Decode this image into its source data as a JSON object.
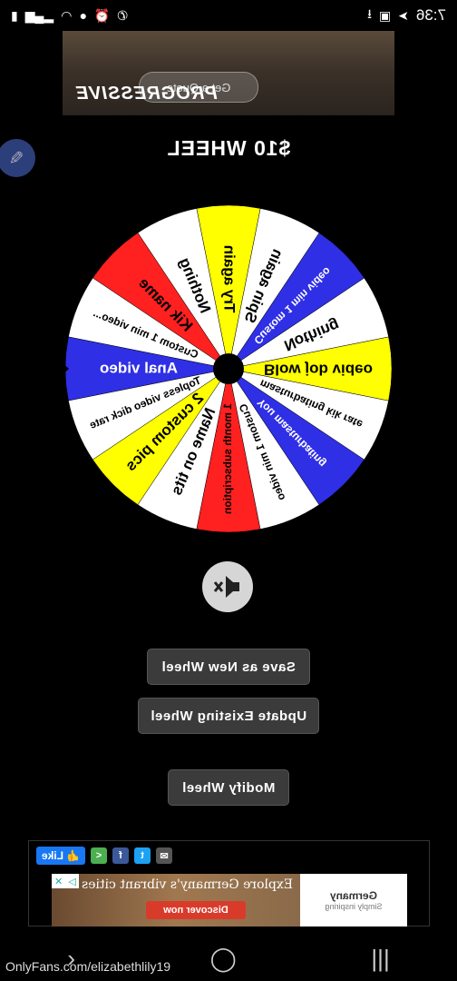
{
  "status_bar": {
    "time": "7:36",
    "left_icons": [
      "download-icon",
      "image-icon",
      "send-icon",
      "notification-icon"
    ],
    "right_icons": [
      "no-call-icon",
      "alarm-icon",
      "location-icon",
      "wifi-icon",
      "signal-icon",
      "battery-icon"
    ]
  },
  "ad_top": {
    "brand": "PROGRESSIVE",
    "cta": "Get a Quote"
  },
  "title": "$10 WHEEL",
  "wheel": {
    "segments": [
      {
        "label": "Nothing",
        "color": "#ffffff"
      },
      {
        "label": "Kik name",
        "color": "#ff2020"
      },
      {
        "label": "Custom 1 min video...",
        "color": "#ffffff"
      },
      {
        "label": "Anal video",
        "color": "#2f2fe6"
      },
      {
        "label": "Topless video dick rate",
        "color": "#ffffff"
      },
      {
        "label": "2 custom pics",
        "color": "#ffff00"
      },
      {
        "label": "Name on tits",
        "color": "#ffffff"
      },
      {
        "label": "1 month subscription",
        "color": "#ff2020"
      },
      {
        "label": "Custom 1 min video",
        "color": "#ffffff"
      },
      {
        "label": "You masturbating",
        "color": "#2f2fe6"
      },
      {
        "label": "masturbating kik rate",
        "color": "#ffffff"
      },
      {
        "label": "Blow job video",
        "color": "#ffff00"
      },
      {
        "label": "Nothing",
        "color": "#ffffff"
      },
      {
        "label": "Custom 1 min video",
        "color": "#2f2fe6"
      },
      {
        "label": "Spin again",
        "color": "#ffffff"
      },
      {
        "label": "Try again",
        "color": "#ffff00"
      }
    ]
  },
  "buttons": {
    "save": "Save as New Wheel",
    "update": "Update Existing Wheel",
    "modify": "Modify Wheel"
  },
  "ad_bottom": {
    "like": "Like",
    "brand": "Germany",
    "tagline": "Simply inspiring",
    "headline": "Explore Germany's vibrant cities",
    "cta": "Discover now"
  },
  "watermark": "OnlyFans.com/elizabethlily19"
}
